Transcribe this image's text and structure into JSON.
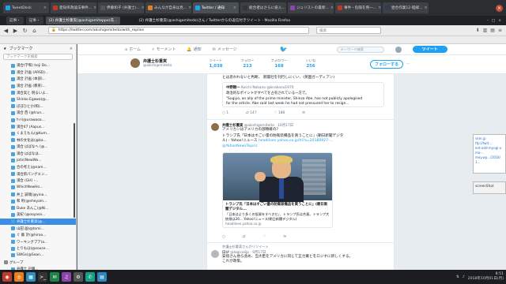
{
  "browser_tabs": [
    {
      "label": "TweetDeck",
      "color": "#1da1f2"
    },
    {
      "label": "愛知県政論法事件...",
      "color": "#c0392b"
    },
    {
      "label": "伊藤和子 (弁護士)...",
      "color": "#555555"
    },
    {
      "label": "みんなが自身は見...",
      "color": "#e67e22"
    },
    {
      "label": "Twitter / 通知",
      "color": "#1da1f2"
    },
    {
      "label": "総合者はさらに投入...",
      "color": "#333333"
    },
    {
      "label": "ジュリストの最新...",
      "color": "#8e44ad"
    },
    {
      "label": "事件・危険を例一...",
      "color": "#c0392b"
    },
    {
      "label": "昼合作業12-経緯...",
      "color": "#2c3e50"
    }
  ],
  "window": {
    "inner_tabs": [
      "記事・",
      "記事・",
      "(2) 弁護士杉重実(@ashigamiteppe)氏..."
    ],
    "title": "(2) 弁護士杉重実(@ashigamitedo)さん / Twitterからの返信付きツイート - Mozilla Firefox"
  },
  "navbar": {
    "url": "https://twitter.com/akishigemiteito/with_replies",
    "search_placeholder": "検索"
  },
  "sidebar": {
    "title": "ブックマーク",
    "close": "×",
    "search_placeholder": "ブックマークを検索",
    "items": [
      {
        "label": "満合(学和) hoji Do...",
        "type": "link"
      },
      {
        "label": "満合 計画 (ARSD)...",
        "type": "link"
      },
      {
        "label": "満合 計画 (本部)...",
        "type": "link"
      },
      {
        "label": "満合 計画 (教育)...",
        "type": "link"
      },
      {
        "label": "満合実と 明るいよ...",
        "type": "link"
      },
      {
        "label": "Shinko Egawa(@...",
        "type": "link"
      },
      {
        "label": "ぼぼひとか(和)...",
        "type": "link"
      },
      {
        "label": "満合 西 (@trun...",
        "type": "link"
      },
      {
        "label": "ｾｯﾄ(@urawaoa...",
        "type": "link"
      },
      {
        "label": "満合47 (Aapus...",
        "type": "link"
      },
      {
        "label": "くまえもん(@Kum...",
        "type": "link"
      },
      {
        "label": "林の文化は(@ba...",
        "type": "link"
      },
      {
        "label": "満合 はばなへ (@...",
        "type": "link"
      },
      {
        "label": "満合 はばなは...",
        "type": "link"
      },
      {
        "label": "jotic(NewWo...",
        "type": "link"
      },
      {
        "label": "合の考え(@nam...",
        "type": "link"
      },
      {
        "label": "満合新パングエン...",
        "type": "link"
      },
      {
        "label": "満合 (GH) -...",
        "type": "link"
      },
      {
        "label": "WhichNewHo...",
        "type": "link"
      },
      {
        "label": "井上 誠哉(@yino...",
        "type": "link"
      },
      {
        "label": "和 利(@eheyam...",
        "type": "link"
      },
      {
        "label": "Duke あんこ(@Ni...",
        "type": "link"
      },
      {
        "label": "美紀 (@ooyasa...",
        "type": "link"
      },
      {
        "label": "弁護士杉重実(@...",
        "type": "link",
        "selected": true
      },
      {
        "label": "山田 画(@tomi...",
        "type": "link"
      },
      {
        "label": "ぐ 藝 計(@hiroo...",
        "type": "link"
      },
      {
        "label": "ワーキングプア(a...",
        "type": "link"
      },
      {
        "label": "とりもほ(@souse...",
        "type": "link"
      },
      {
        "label": "SWGs(@Sean...",
        "type": "link"
      },
      {
        "label": "グループ",
        "type": "folder"
      },
      {
        "label": "弁護士 戸籍...",
        "type": "link"
      },
      {
        "label": "ハーマイン(@hanr...",
        "type": "link"
      }
    ]
  },
  "twitter": {
    "top_nav": [
      {
        "label": "ホーム",
        "icon": "home-icon"
      },
      {
        "label": "モーメント",
        "icon": "lightning-icon"
      },
      {
        "label": "通知",
        "icon": "bell-icon"
      },
      {
        "label": "メッセージ",
        "icon": "envelope-icon"
      }
    ],
    "search_placeholder": "キーワード検索",
    "tweet_button": "ツイート",
    "profile": {
      "name": "弁護士杉重実",
      "handle": "@akishigemiteito",
      "stats": [
        {
          "label": "ツイート",
          "value": "1,038"
        },
        {
          "label": "フォロー",
          "value": "213"
        },
        {
          "label": "フォロワー",
          "value": "168"
        },
        {
          "label": "いいね",
          "value": "256"
        }
      ],
      "follow_button": "フォローする",
      "more": "⋯"
    },
    "tweets": [
      {
        "text_top": "とは思われないと判断、 新聞社を刊行しにくい、(英国ガーディアン)",
        "quote_name": "中野剛一",
        "quote_sub": "Koichi Nakano @knakano1970",
        "quote_line1": "政治的なポイントがすべてを占有されている一方で。",
        "quote_line2": "\"Sugiyo, an ally of the prime minister, Shinzo Abe, has not publicly apologised",
        "quote_line3": "for the article. Abe said last week he had not pressured her to resign...",
        "actions": [
          "○ 1",
          "⇄ 147",
          "♡ 188",
          "✉"
        ]
      },
      {
        "author": "弁護士杉重実",
        "handle": "@akishigemiteito · 10月17日",
        "line1": "アメリカンはアメリカの部類確の?",
        "line2": "トランプ氏「日本はすごい量の防衛装備品を買うことに」(朝日新聞デジタ",
        "line3": "ル) - Yahoo!ニュース",
        "link": "headlines.yahoo.co.jp/hl?a=20180927-...",
        "mention": "@YahooNewsTopics",
        "card_title": "トランプ氏「日本はすごい量の防衛装備品を買うことに」(朝日新聞デジタル...",
        "card_desc": "「日本はより多くの投資をすべきだ」、トランプ氏は合意。トランプ大統領は26... Yahoo!ニュース(朝日新聞デジタル)",
        "card_domain": "headlines.yahoo.co.jp",
        "actions": [
          "○",
          "⇄",
          "♡",
          "✉"
        ]
      },
      {
        "reply_note": "弁護士杉重実さんがリツイート",
        "author": "ロジ",
        "handle": "@logicalijp · 9月17日",
        "line1": "安倍さん他ら含め、当大臣をアメリカに同じて正力賞とをロジすに新しくする。",
        "line2": "これが政策。"
      }
    ]
  },
  "bg_windows": {
    "win1_lines": [
      "vkm.jp",
      "ttp://twit...",
      "ent-add-myogi-uma-...",
      "mey.wp.../2018/1..."
    ],
    "win2_label": "screenShot"
  },
  "taskbar": {
    "icons": [
      {
        "icon": "menu-icon",
        "color": "#c0392b"
      },
      {
        "icon": "browser-icon",
        "color": "#e67e22"
      },
      {
        "icon": "files-icon",
        "color": "#2c8fbf"
      },
      {
        "icon": "terminal-icon",
        "color": "#333"
      },
      {
        "icon": "mail-icon",
        "color": "#1e8449"
      },
      {
        "icon": "music-icon",
        "color": "#8e44ad"
      },
      {
        "icon": "settings-icon",
        "color": "#555"
      },
      {
        "icon": "chat-icon",
        "color": "#16a085"
      },
      {
        "icon": "doc-icon",
        "color": "#2e86c1"
      }
    ],
    "clock_time": "8:51",
    "clock_date": "2018年10月01日(月)"
  }
}
